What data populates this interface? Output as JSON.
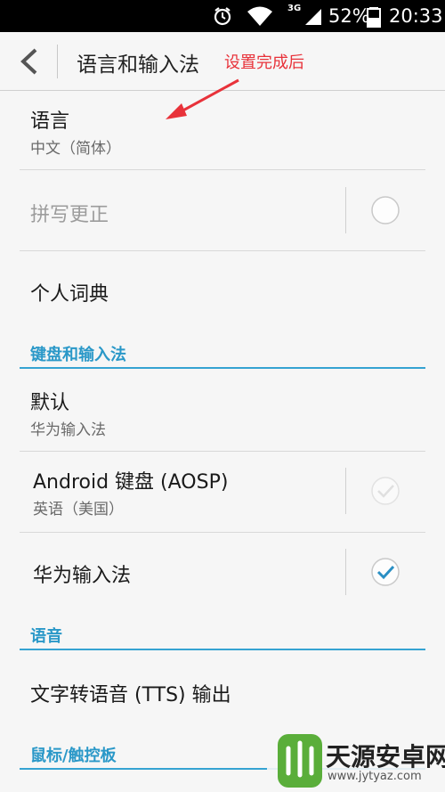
{
  "status_bar": {
    "network": "3G",
    "battery_percent": "52%",
    "time": "20:33",
    "icons": [
      "alarm-icon",
      "wifi-icon",
      "signal-icon",
      "battery-icon"
    ]
  },
  "action_bar": {
    "title": "语言和输入法",
    "annotation": "设置完成后",
    "annotation_color": "#e8323a"
  },
  "items": {
    "language": {
      "title": "语言",
      "subtitle": "中文（简体）"
    },
    "spell_check": {
      "title": "拼写更正",
      "checked": false,
      "enabled": false
    },
    "personal_dict": {
      "title": "个人词典"
    }
  },
  "sections": {
    "keyboard": "键盘和输入法",
    "speech": "语音",
    "mouse": "鼠标/触控板"
  },
  "keyboard_items": {
    "default": {
      "title": "默认",
      "subtitle": "华为输入法"
    },
    "aosp": {
      "title": "Android 键盘 (AOSP)",
      "subtitle": "英语（美国）",
      "checked": true,
      "enabled": false
    },
    "huawei": {
      "title": "华为输入法",
      "checked": true,
      "enabled": true
    }
  },
  "speech_items": {
    "tts": {
      "title": "文字转语音 (TTS) 输出"
    }
  },
  "watermark": {
    "name": "天源安卓网",
    "url": "www.jytyaz.com"
  },
  "colors": {
    "accent": "#35a3d2",
    "check_blue": "#2a8fc4"
  }
}
